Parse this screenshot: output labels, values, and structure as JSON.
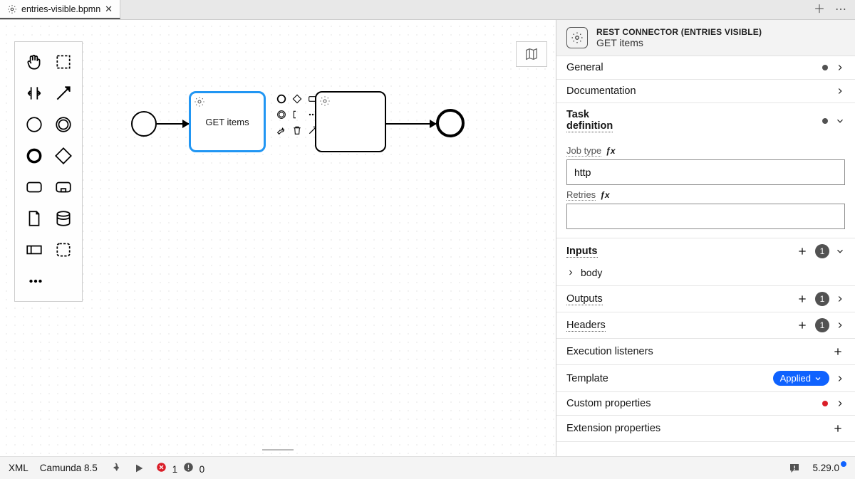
{
  "tab": {
    "filename": "entries-visible.bpmn"
  },
  "canvas": {
    "task_label": "GET items"
  },
  "panel": {
    "title": "REST CONNECTOR (ENTRIES VISIBLE)",
    "subtitle": "GET items",
    "sections": {
      "general": "General",
      "documentation": "Documentation",
      "task_definition": "Task definition",
      "inputs": "Inputs",
      "outputs": "Outputs",
      "headers": "Headers",
      "execution_listeners": "Execution listeners",
      "template": "Template",
      "custom_properties": "Custom properties",
      "extension_properties": "Extension properties"
    },
    "task_def": {
      "job_type_label": "Job type",
      "job_type_value": "http",
      "retries_label": "Retries",
      "retries_value": ""
    },
    "inputs": {
      "count": "1",
      "item1": "body"
    },
    "outputs": {
      "count": "1"
    },
    "headers": {
      "count": "1"
    },
    "template": {
      "applied": "Applied"
    }
  },
  "footer": {
    "xml": "XML",
    "engine": "Camunda 8.5",
    "errors": "1",
    "warnings": "0",
    "version": "5.29.0"
  }
}
